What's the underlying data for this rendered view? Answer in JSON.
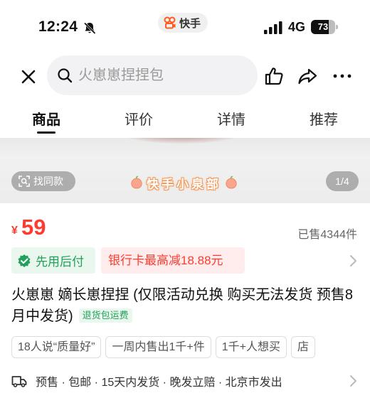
{
  "status_bar": {
    "time": "12:24",
    "app_name": "快手",
    "network": "4G",
    "battery": "73",
    "battery_level": 0.73
  },
  "header": {
    "search_placeholder": "火崽崽捏捏包"
  },
  "tabs": [
    {
      "label": "商品",
      "active": true
    },
    {
      "label": "评价",
      "active": false
    },
    {
      "label": "详情",
      "active": false
    },
    {
      "label": "推荐",
      "active": false
    }
  ],
  "gallery": {
    "same_style_label": "找同款",
    "watermark": "快手小泉部",
    "page_indicator": "1/4"
  },
  "price": {
    "currency": "¥",
    "value": "59",
    "sold": "已售4344件"
  },
  "tags": {
    "payment": "先用后付",
    "bank_discount": "银行卡最高减18.88元"
  },
  "product": {
    "title": "火崽崽 嫡长崽捏捏 (仅限活动兑换 购买无法发货 预售8月中发货)",
    "return_badge": "退货包运费"
  },
  "chips": [
    "18人说“质量好”",
    "一周内售出1千+件",
    "1千+人想买",
    "店"
  ],
  "shipping": {
    "text": "预售 · 包邮 · 15天内发货 · 晚发立赔 · 北京市发出"
  },
  "colors": {
    "price_red": "#ff3b30",
    "tag_green": "#22a15a",
    "tag_green_bg": "#e9f7ee",
    "tag_red_bg": "#ffeded"
  }
}
